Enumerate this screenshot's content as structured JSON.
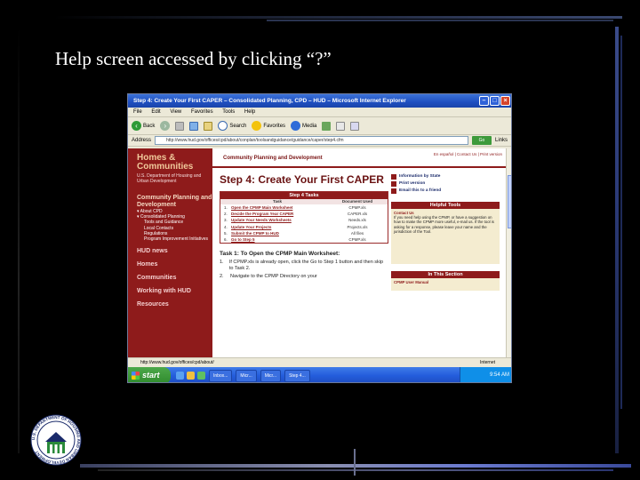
{
  "slide": {
    "title": "Help screen accessed by clicking “?”"
  },
  "logo": {
    "text": "U.S. DEPARTMENT OF HOUSING AND URBAN DEVELOPMENT"
  },
  "browser": {
    "title": "Step 4: Create Your First CAPER – Consolidated Planning, CPD – HUD – Microsoft Internet Explorer",
    "menu": [
      "File",
      "Edit",
      "View",
      "Favorites",
      "Tools",
      "Help"
    ],
    "toolbar": {
      "back": "Back",
      "search": "Search",
      "favorites": "Favorites",
      "media": "Media"
    },
    "address_label": "Address",
    "address": "http://www.hud.gov/offices/cpd/about/conplan/toolsandguidance/guidance/caper/step4.cfm",
    "go_label": "Go",
    "links_label": "Links",
    "status": "http://www.hud.gov/offices/cpd/about/",
    "zone": "Internet"
  },
  "site": {
    "brand_line1": "Homes &",
    "brand_line2": "Communities",
    "brand_sub": "U.S. Department of Housing and Urban Development",
    "header_title": "Community Planning and Development",
    "header_links": "En español | Contact Us | Print version",
    "nav": {
      "heading": "Community Planning and Development",
      "items": [
        "▾ About CPD",
        "▾ Consolidated Planning",
        "Tools and Guidance",
        "Local Contacts",
        "Regulations",
        "Program Improvement Initiatives"
      ],
      "main": [
        "HUD news",
        "Homes",
        "Communities",
        "Working with HUD",
        "Resources"
      ]
    },
    "step_title": "Step 4: Create Your First CAPER",
    "tasks": {
      "heading": "Step 4 Tasks",
      "col_task": "Task",
      "col_doc": "Document Used",
      "rows": [
        {
          "n": "1.",
          "task": "Open the CPMP Main Worksheet",
          "doc": "CPMP.xls"
        },
        {
          "n": "2.",
          "task": "Decide the Program Year CAPER",
          "doc": "CAPER.xls"
        },
        {
          "n": "3.",
          "task": "Update Your Needs Worksheets",
          "doc": "Needs.xls"
        },
        {
          "n": "4.",
          "task": "Update Your Projects",
          "doc": "Projects.xls"
        },
        {
          "n": "5.",
          "task": "Submit the CPMP to HUD",
          "doc": "All files"
        },
        {
          "n": "6.",
          "task": "Go to Step 5",
          "doc": "CPMP.xls"
        }
      ]
    },
    "task1": {
      "title": "Task 1: To Open the CPMP Main Worksheet:",
      "steps": [
        {
          "n": "1.",
          "text": "If CPMP.xls is already open, click the Go to Step 1 button and then skip to Task 2."
        },
        {
          "n": "2.",
          "text": "Navigate to the CPMP Directory on your"
        }
      ]
    },
    "right": {
      "links": [
        "Information by State",
        "Print version",
        "Email this to a friend"
      ],
      "helpful_heading": "Helpful Tools",
      "helpful_body_title": "Contact Us",
      "helpful_body": "If you need help using the CPMP, or have a suggestion on how to make the CPMP more useful, e-mail us. If the tool is asking for a response, please leave your name and the jurisdiction of the Tool.",
      "section_heading": "In This Section",
      "section_link": "CPMP User Manual"
    }
  },
  "taskbar": {
    "start": "start",
    "buttons": [
      "Inbox...",
      "Micr...",
      "Micr...",
      "Step 4..."
    ],
    "time": "9:54 AM"
  },
  "colors": {
    "hud_red": "#8e1b1b",
    "xp_blue": "#245ddc",
    "start_green": "#2f8a2c"
  }
}
